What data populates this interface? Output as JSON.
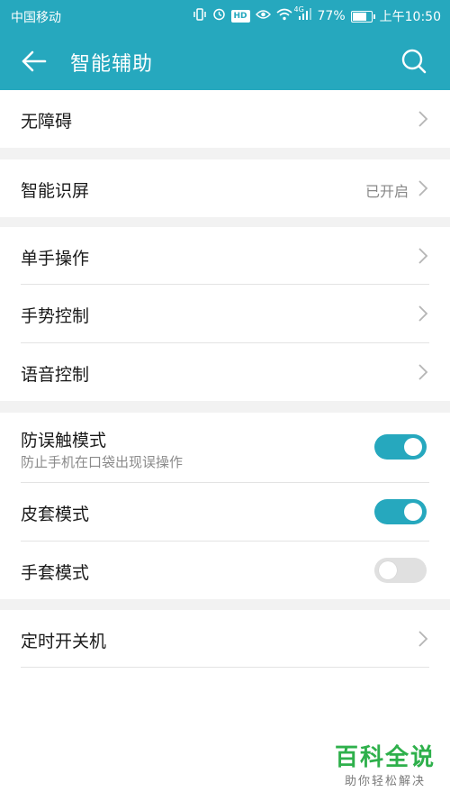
{
  "status_bar": {
    "carrier": "中国移动",
    "network": "4G",
    "battery_percent": "77%",
    "battery_level": 0.77,
    "time": "上午10:50",
    "icons": [
      "vibrate-icon",
      "alarm-icon",
      "hd-icon",
      "eye-icon",
      "wifi-icon",
      "signal-icon",
      "battery-icon"
    ]
  },
  "app_bar": {
    "title": "智能辅助",
    "back_icon": "arrow-left-icon",
    "search_icon": "search-icon"
  },
  "groups": [
    {
      "items": [
        {
          "label": "无障碍",
          "type": "link"
        }
      ]
    },
    {
      "items": [
        {
          "label": "智能识屏",
          "type": "link",
          "value": "已开启"
        }
      ]
    },
    {
      "items": [
        {
          "label": "单手操作",
          "type": "link"
        },
        {
          "label": "手势控制",
          "type": "link"
        },
        {
          "label": "语音控制",
          "type": "link"
        }
      ]
    },
    {
      "items": [
        {
          "label": "防误触模式",
          "subtitle": "防止手机在口袋出现误操作",
          "type": "toggle",
          "on": true
        },
        {
          "label": "皮套模式",
          "type": "toggle",
          "on": true
        },
        {
          "label": "手套模式",
          "type": "toggle",
          "on": false
        }
      ]
    },
    {
      "items": [
        {
          "label": "定时开关机",
          "type": "link"
        }
      ]
    }
  ],
  "watermark": {
    "title": "百科全说",
    "subtitle": "助你轻松解决"
  },
  "colors": {
    "accent": "#26a8be",
    "background": "#f2f2f2",
    "toggle_off": "#e0e0e0",
    "watermark": "#2eb04b"
  }
}
